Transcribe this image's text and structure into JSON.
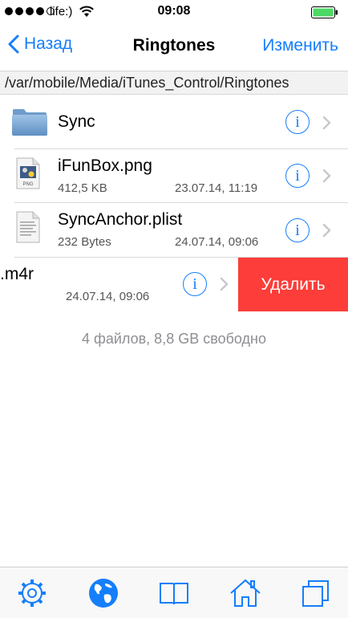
{
  "status_bar": {
    "carrier": "life:)",
    "time": "09:08"
  },
  "nav": {
    "back_label": "Назад",
    "title": "Ringtones",
    "edit_label": "Изменить"
  },
  "path": "/var/mobile/Media/iTunes_Control/Ringtones",
  "files": [
    {
      "name": "Sync",
      "type": "folder"
    },
    {
      "name": "iFunBox.png",
      "size": "412,5 KB",
      "date": "23.07.14, 11:19",
      "type": "image"
    },
    {
      "name": "SyncAnchor.plist",
      "size": "232 Bytes",
      "date": "24.07.14, 09:06",
      "type": "document"
    },
    {
      "name": ".m4r",
      "date": "24.07.14, 09:06",
      "type": "audio",
      "delete_label": "Удалить"
    }
  ],
  "footer": "4 файлов, 8,8 GB свободно",
  "tabs": [
    {
      "icon": "gear-icon"
    },
    {
      "icon": "globe-icon"
    },
    {
      "icon": "book-icon"
    },
    {
      "icon": "home-icon"
    },
    {
      "icon": "windows-icon"
    }
  ],
  "colors": {
    "accent": "#157efb",
    "delete": "#fc3d39",
    "separator": "#d9d9d9",
    "secondary_text": "#8e8e93"
  }
}
